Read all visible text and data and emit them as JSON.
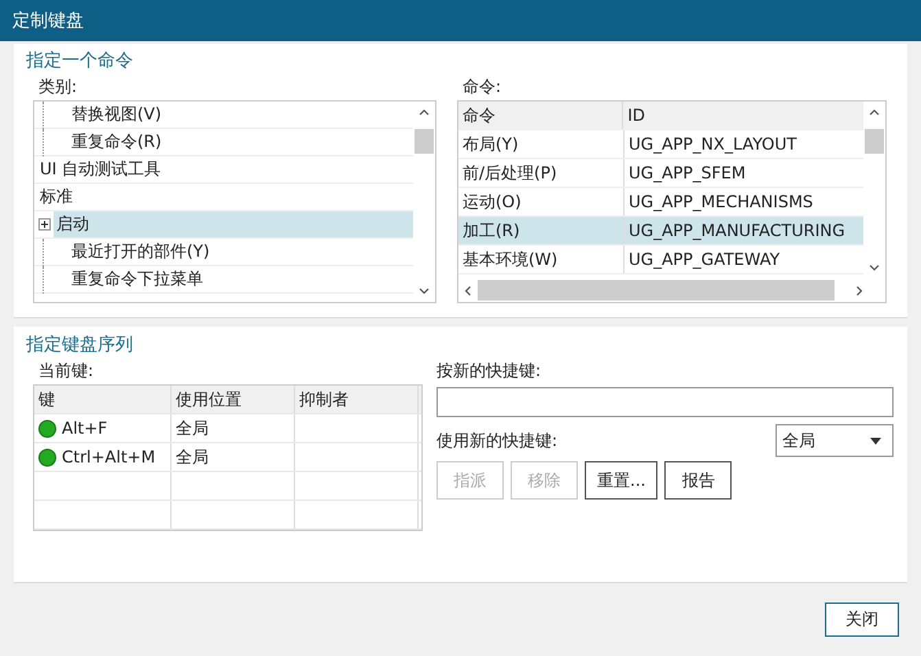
{
  "window": {
    "title": "定制键盘"
  },
  "command_section": {
    "title": "指定一个命令",
    "category_label": "类别:",
    "categories": [
      {
        "children": [
          {
            "label": "替换视图(V)",
            "selected": false
          },
          {
            "label": "重复命令(R)",
            "selected": false
          }
        ]
      },
      {
        "label": "UI 自动测试工具",
        "selected": false
      },
      {
        "label": "标准",
        "selected": false,
        "children": [
          {
            "label": "启动",
            "selected": true,
            "expanded": false
          },
          {
            "label": "最近打开的部件(Y)",
            "selected": false
          },
          {
            "label": "重复命令下拉菜单",
            "selected": false
          }
        ]
      }
    ],
    "commands_label": "命令:",
    "commands_table": {
      "columns": [
        "命令",
        "ID"
      ],
      "rows": [
        {
          "cells": [
            "布局(Y)",
            "UG_APP_NX_LAYOUT"
          ],
          "selected": false
        },
        {
          "cells": [
            "前/后处理(P)",
            "UG_APP_SFEM"
          ],
          "selected": false
        },
        {
          "cells": [
            "运动(O)",
            "UG_APP_MECHANISMS"
          ],
          "selected": false
        },
        {
          "cells": [
            "加工(R)",
            "UG_APP_MANUFACTURING"
          ],
          "selected": true
        },
        {
          "cells": [
            "基本环境(W)",
            "UG_APP_GATEWAY"
          ],
          "selected": false
        }
      ]
    }
  },
  "sequence_section": {
    "title": "指定键盘序列",
    "current_label": "当前键:",
    "keys_table": {
      "columns": [
        "键",
        "使用位置",
        "抑制者"
      ],
      "rows": [
        {
          "key": "Alt+F",
          "location": "全局",
          "color": "#22aa22"
        },
        {
          "key": "Ctrl+Alt+M",
          "location": "全局",
          "color": "#22aa22"
        }
      ]
    },
    "new_key_label": "按新的快捷键:",
    "use_label": "使用新的快捷键:",
    "scope": "全局",
    "buttons": [
      {
        "label": "指派",
        "disabled": true
      },
      {
        "label": "移除",
        "disabled": true
      },
      {
        "label": "重置...",
        "disabled": false
      },
      {
        "label": "报告",
        "disabled": false
      }
    ]
  },
  "close_button": "关闭"
}
